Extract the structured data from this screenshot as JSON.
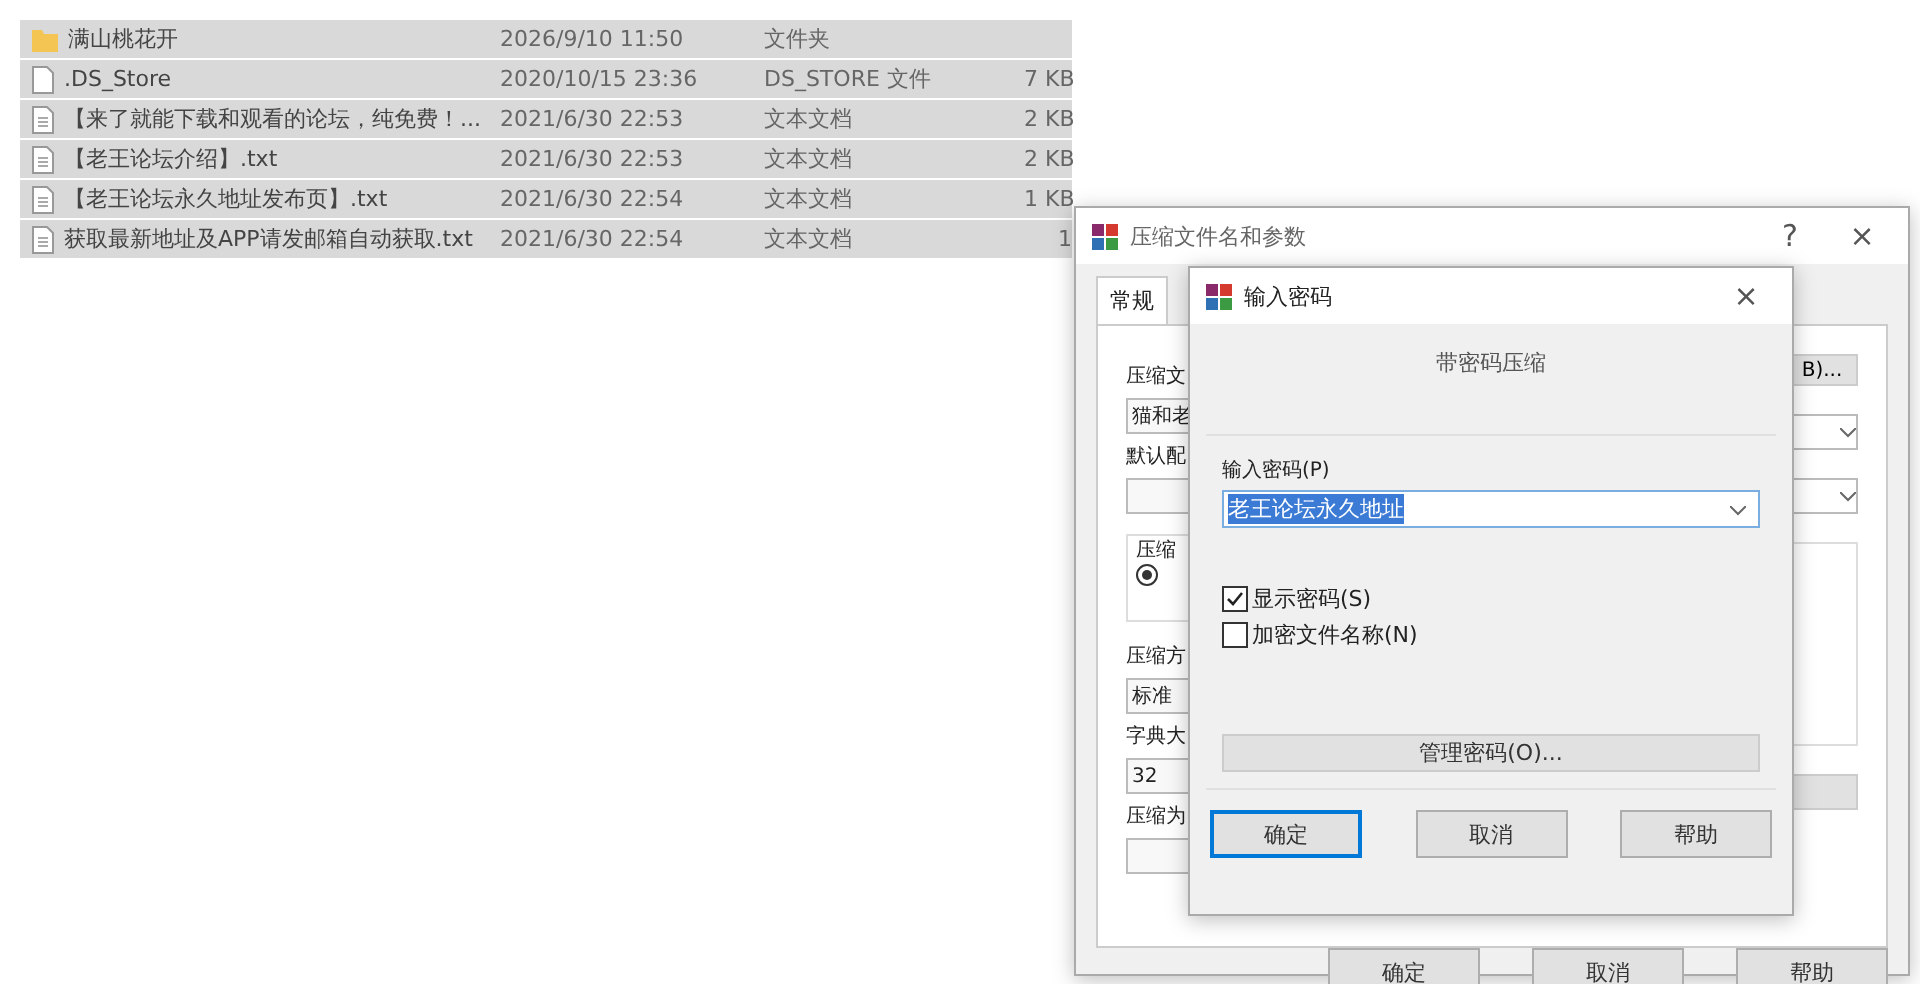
{
  "file_list": {
    "rows": [
      {
        "kind": "folder",
        "name": "满山桃花开",
        "modified": "2026/9/10 11:50",
        "type": "文件夹",
        "selected": true
      },
      {
        "kind": "file",
        "name": ".DS_Store",
        "modified": "2020/10/15 23:36",
        "type": "DS_STORE 文件",
        "size": "7 KB",
        "selected": true
      },
      {
        "kind": "text",
        "name": "【来了就能下载和观看的论坛，纯免费！...",
        "modified": "2021/6/30 22:53",
        "type": "文本文档",
        "size": "2 KB",
        "selected": true
      },
      {
        "kind": "text",
        "name": "【老王论坛介绍】.txt",
        "modified": "2021/6/30 22:53",
        "type": "文本文档",
        "size": "2 KB",
        "selected": true
      },
      {
        "kind": "text",
        "name": "【老王论坛永久地址发布页】.txt",
        "modified": "2021/6/30 22:54",
        "type": "文本文档",
        "size": "1 KB",
        "selected": true
      },
      {
        "kind": "text",
        "name": "获取最新地址及APP请发邮箱自动获取.txt",
        "modified": "2021/6/30 22:54",
        "type": "文本文档",
        "size": "1",
        "selected": true
      }
    ]
  },
  "archive_dialog": {
    "title": "压缩文件名和参数",
    "help": "?",
    "close": "×",
    "tabs": [
      {
        "label": "常规",
        "selected": true
      }
    ],
    "left_labels": [
      {
        "kind": "label",
        "text": "压缩文"
      },
      {
        "kind": "field",
        "text": "猫和老"
      },
      {
        "kind": "label",
        "text": "默认配"
      },
      {
        "kind": "field"
      },
      {
        "kind": "group",
        "text": "压缩"
      },
      {
        "kind": "label",
        "text": "压缩方"
      },
      {
        "kind": "field",
        "text": "标准"
      },
      {
        "kind": "label",
        "text": "字典大"
      },
      {
        "kind": "field",
        "text": "32"
      },
      {
        "kind": "label",
        "text": "压缩为"
      },
      {
        "kind": "field"
      }
    ],
    "side_button": "B)...",
    "buttons": [
      {
        "label": "确定"
      },
      {
        "label": "取消"
      },
      {
        "label": "帮助"
      }
    ]
  },
  "password_dialog": {
    "title": "输入密码",
    "close": "×",
    "heading": "带密码压缩",
    "password_label": "输入密码(P)",
    "password_value": "老王论坛永久地址",
    "checkboxes": [
      {
        "label": "显示密码(S)",
        "checked": true
      },
      {
        "label": "加密文件名称(N)",
        "checked": false
      }
    ],
    "manage_button": "管理密码(O)...",
    "buttons": [
      {
        "label": "确定",
        "default": true
      },
      {
        "label": "取消",
        "default": false
      },
      {
        "label": "帮助",
        "default": false
      }
    ]
  }
}
